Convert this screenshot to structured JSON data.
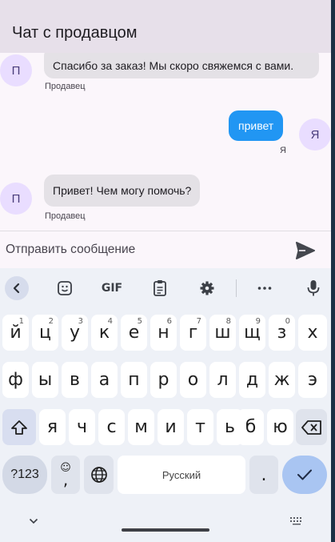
{
  "app": {
    "title": "Чат с продавцом"
  },
  "messages": [
    {
      "avatar": "П",
      "text": "Спасибо за заказ! Мы скоро свяжемся с вами.",
      "sender": "Продавец"
    },
    {
      "avatar": "Я",
      "text": "привет",
      "sender": "Я"
    },
    {
      "avatar": "П",
      "text": "Привет! Чем могу помочь?",
      "sender": "Продавец"
    }
  ],
  "composer": {
    "placeholder": "Отправить сообщение",
    "send_icon": "send-icon"
  },
  "keyboard": {
    "toolbar": [
      "back-icon",
      "emoji-sticker-icon",
      "GIF",
      "clipboard-icon",
      "settings-icon",
      "more-icon",
      "mic-icon"
    ],
    "gif_label": "GIF",
    "row1": [
      {
        "k": "й",
        "h": "1"
      },
      {
        "k": "ц",
        "h": "2"
      },
      {
        "k": "у",
        "h": "3"
      },
      {
        "k": "к",
        "h": "4"
      },
      {
        "k": "е",
        "h": "5"
      },
      {
        "k": "н",
        "h": "6"
      },
      {
        "k": "г",
        "h": "7"
      },
      {
        "k": "ш",
        "h": "8"
      },
      {
        "k": "щ",
        "h": "9"
      },
      {
        "k": "з",
        "h": "0"
      },
      {
        "k": "х",
        "h": ""
      }
    ],
    "row2": [
      "ф",
      "ы",
      "в",
      "а",
      "п",
      "р",
      "о",
      "л",
      "д",
      "ж",
      "э"
    ],
    "row3": [
      "я",
      "ч",
      "с",
      "м",
      "и",
      "т",
      "ь",
      "б",
      "ю"
    ],
    "sym_label": "?123",
    "emoji_comma_top": "☺",
    "emoji_comma_bottom": ",",
    "space_label": "Русский",
    "period_label": ".",
    "colors": {
      "accent": "#2196f3",
      "enter": "#a9c5f2",
      "avatar": "#e9ddff"
    }
  }
}
